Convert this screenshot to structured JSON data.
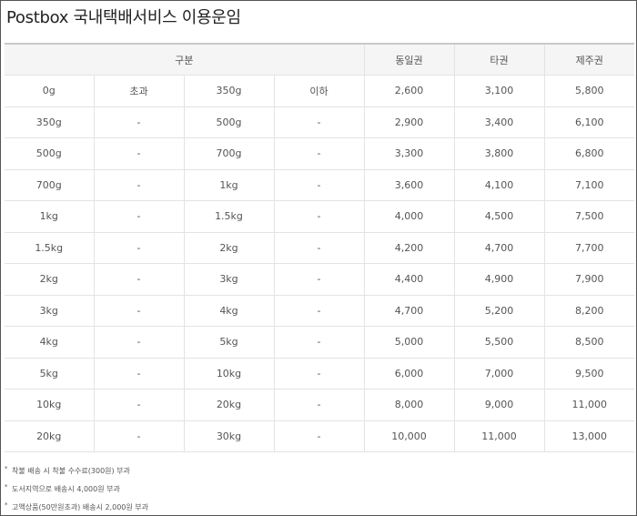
{
  "page": {
    "title": "Postbox 국내택배서비스 이용운임"
  },
  "table": {
    "headers": [
      "구분",
      "동일권",
      "타권",
      "제주권"
    ],
    "rows": [
      [
        "0g",
        "초과",
        "350g",
        "이하",
        "2,600",
        "3,100",
        "5,800"
      ],
      [
        "350g",
        "-",
        "500g",
        "-",
        "2,900",
        "3,400",
        "6,100"
      ],
      [
        "500g",
        "-",
        "700g",
        "-",
        "3,300",
        "3,800",
        "6,800"
      ],
      [
        "700g",
        "-",
        "1kg",
        "-",
        "3,600",
        "4,100",
        "7,100"
      ],
      [
        "1kg",
        "-",
        "1.5kg",
        "-",
        "4,000",
        "4,500",
        "7,500"
      ],
      [
        "1.5kg",
        "-",
        "2kg",
        "-",
        "4,200",
        "4,700",
        "7,700"
      ],
      [
        "2kg",
        "-",
        "3kg",
        "-",
        "4,400",
        "4,900",
        "7,900"
      ],
      [
        "3kg",
        "-",
        "4kg",
        "-",
        "4,700",
        "5,200",
        "8,200"
      ],
      [
        "4kg",
        "-",
        "5kg",
        "-",
        "5,000",
        "5,500",
        "8,500"
      ],
      [
        "5kg",
        "-",
        "10kg",
        "-",
        "6,000",
        "7,000",
        "9,500"
      ],
      [
        "10kg",
        "-",
        "20kg",
        "-",
        "8,000",
        "9,000",
        "11,000"
      ],
      [
        "20kg",
        "-",
        "30kg",
        "-",
        "10,000",
        "11,000",
        "13,000"
      ]
    ]
  },
  "notes": {
    "marker": "*",
    "items": [
      "착불 배송 시 착불 수수료(300원) 부과",
      "도서지역으로 배송시 4,000원 부과",
      "고액상품(50만원초과) 배송시 2,000원 부과"
    ]
  }
}
